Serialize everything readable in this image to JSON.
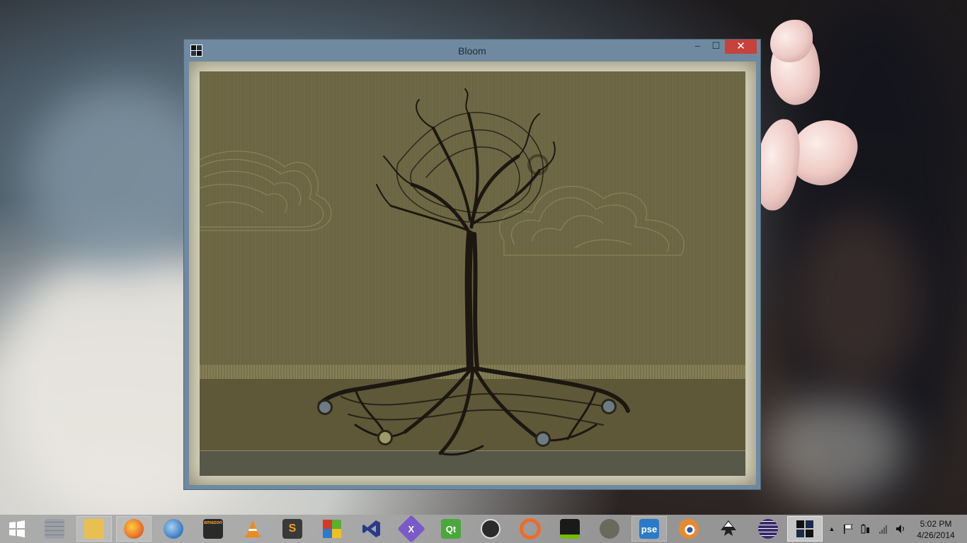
{
  "window": {
    "title": "Bloom",
    "minimize_glyph": "–",
    "maximize_glyph": "☐",
    "close_glyph": "✕"
  },
  "taskbar": {
    "start_icon": "windows-logo-icon",
    "items": [
      {
        "name": "wall-app",
        "icon": "brick-wall-icon",
        "label": "",
        "color": "#8a8f95"
      },
      {
        "name": "file-explorer",
        "icon": "folder-icon",
        "label": "",
        "color": "#e8c050"
      },
      {
        "name": "firefox",
        "icon": "firefox-icon",
        "label": "",
        "color": "#e8742a"
      },
      {
        "name": "thunderbird",
        "icon": "thunderbird-icon",
        "label": "",
        "color": "#3a78c0"
      },
      {
        "name": "amazon-mp3",
        "icon": "amazon-icon",
        "label": "amazon",
        "color": "#2a2a2a"
      },
      {
        "name": "vlc",
        "icon": "vlc-cone-icon",
        "label": "",
        "color": "#f08a1c"
      },
      {
        "name": "sublime-text",
        "icon": "sublime-icon",
        "label": "S",
        "color": "#3a3a3a"
      },
      {
        "name": "office-app",
        "icon": "office-tiles-icon",
        "label": "",
        "color": "#d43a2a"
      },
      {
        "name": "visual-studio",
        "icon": "visual-studio-icon",
        "label": "",
        "color": "#2a3a8a"
      },
      {
        "name": "xamarin",
        "icon": "xamarin-icon",
        "label": "X",
        "color": "#7a5ac8"
      },
      {
        "name": "qt-creator",
        "icon": "qt-icon",
        "label": "Qt",
        "color": "#4aa83a"
      },
      {
        "name": "steam",
        "icon": "steam-icon",
        "label": "",
        "color": "#2a2a2a"
      },
      {
        "name": "origin",
        "icon": "origin-icon",
        "label": "",
        "color": "#f06a2a"
      },
      {
        "name": "nvidia",
        "icon": "nvidia-icon",
        "label": "",
        "color": "#1a1a1a"
      },
      {
        "name": "gimp",
        "icon": "gimp-icon",
        "label": "",
        "color": "#6a6a5a"
      },
      {
        "name": "photoshop-elements",
        "icon": "pse-icon",
        "label": "pse",
        "color": "#2a7ac8"
      },
      {
        "name": "blender",
        "icon": "blender-icon",
        "label": "",
        "color": "#e88a2a"
      },
      {
        "name": "inkscape",
        "icon": "inkscape-icon",
        "label": "",
        "color": "#222222"
      },
      {
        "name": "eclipse",
        "icon": "eclipse-icon",
        "label": "",
        "color": "#3a2a6a"
      },
      {
        "name": "bloom",
        "icon": "bloom-app-icon",
        "label": "",
        "color": "#1a2a4a"
      }
    ],
    "tray": {
      "show_hidden_icon": "chevron-up-icon",
      "flag_icon": "action-center-flag-icon",
      "battery_icon": "battery-icon",
      "network_icon": "network-signal-icon",
      "volume_icon": "volume-icon"
    },
    "clock": {
      "time": "5:02 PM",
      "date": "4/26/2014"
    }
  }
}
